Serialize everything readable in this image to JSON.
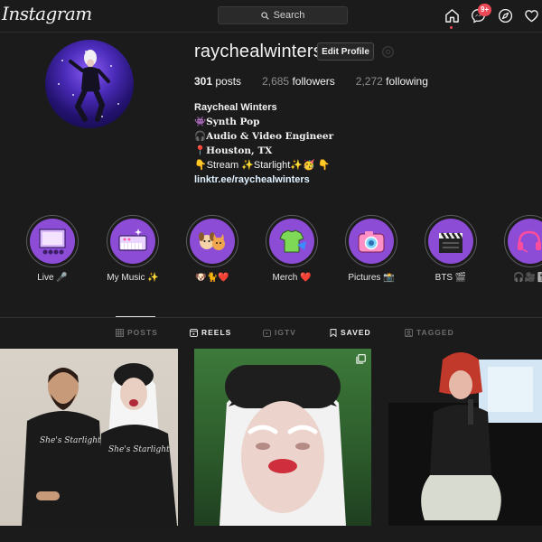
{
  "nav": {
    "logo": "Instagram",
    "search_placeholder": "Search",
    "notification_count": "9+"
  },
  "profile": {
    "username": "raycheal​winters",
    "edit_label": "Edit Profile",
    "stats": {
      "posts_count": "301",
      "posts_label": "posts",
      "followers_count": "2,685",
      "followers_label": "followers",
      "following_count": "2,272",
      "following_label": "following"
    },
    "bio": {
      "name": "Raycheal Winters",
      "line1": "👾Synth Pop",
      "line2": "🎧Audio & Video Engineer",
      "line3": "📍Houston, TX",
      "line4": "👇Stream ✨Starlight✨🥳 👇",
      "link": "linktr.ee/raychealwinters"
    }
  },
  "highlights": [
    {
      "label": "Live 🎤",
      "icon": "concert-stage-icon"
    },
    {
      "label": "My Music ✨",
      "icon": "synth-keyboard-icon"
    },
    {
      "label": "🐶🐈❤️",
      "icon": "pets-icon"
    },
    {
      "label": "Merch ❤️",
      "icon": "tshirt-icon"
    },
    {
      "label": "Pictures 📸",
      "icon": "camera-icon"
    },
    {
      "label": "BTS 🎬",
      "icon": "clapperboard-icon"
    },
    {
      "label": "🎧🎥🎚️",
      "icon": "headset-icon"
    }
  ],
  "tabs": [
    {
      "label": "POSTS",
      "icon": "grid-icon",
      "active": false
    },
    {
      "label": "REELS",
      "icon": "reels-icon",
      "active": true
    },
    {
      "label": "IGTV",
      "icon": "igtv-icon",
      "active": false
    },
    {
      "label": "SAVED",
      "icon": "bookmark-icon",
      "active": true
    },
    {
      "label": "TAGGED",
      "icon": "tag-icon",
      "active": false
    }
  ],
  "posts": [
    {
      "shirt_text_left": "She's Starlight",
      "shirt_text_right": "She's Starlight"
    },
    {
      "multi_image": true
    },
    {}
  ],
  "colors": {
    "background": "#1b1b1b",
    "highlight_purple": "#8c4cd6",
    "notification_red": "#ed4956",
    "link": "#e0f1ff"
  }
}
